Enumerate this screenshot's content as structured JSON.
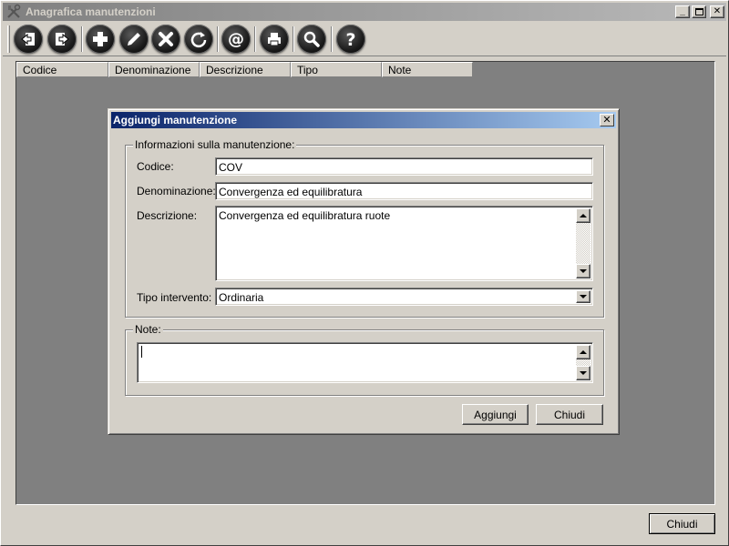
{
  "window": {
    "title": "Anagrafica manutenzioni",
    "icon": "tools-icon"
  },
  "toolbar": {
    "buttons": [
      {
        "name": "first",
        "icon": "first-record-icon"
      },
      {
        "name": "last",
        "icon": "last-record-icon"
      },
      {
        "name": "add",
        "icon": "plus-icon"
      },
      {
        "name": "edit",
        "icon": "pencil-icon"
      },
      {
        "name": "delete",
        "icon": "x-icon"
      },
      {
        "name": "refresh",
        "icon": "refresh-icon"
      },
      {
        "name": "email",
        "icon": "at-icon"
      },
      {
        "name": "print",
        "icon": "printer-icon"
      },
      {
        "name": "search",
        "icon": "magnifier-icon"
      },
      {
        "name": "help",
        "icon": "question-icon"
      }
    ]
  },
  "grid": {
    "columns": [
      "Codice",
      "Denominazione",
      "Descrizione",
      "Tipo",
      "Note"
    ]
  },
  "main": {
    "close_label": "Chiudi"
  },
  "dialog": {
    "title": "Aggiungi manutenzione",
    "info_group_label": "Informazioni sulla manutenzione:",
    "codice_label": "Codice:",
    "codice_value": "COV",
    "denominazione_label": "Denominazione:",
    "denominazione_value": "Convergenza ed equilibratura",
    "descrizione_label": "Descrizione:",
    "descrizione_value": "Convergenza ed equilibratura ruote",
    "tipo_label": "Tipo intervento:",
    "tipo_value": "Ordinaria",
    "note_group_label": "Note:",
    "note_value": "",
    "add_label": "Aggiungi",
    "close_label": "Chiudi"
  },
  "colors": {
    "active_title_start": "#0a246a",
    "active_title_end": "#a6caf0",
    "face": "#d4d0c8",
    "grid_bg": "#808080"
  }
}
